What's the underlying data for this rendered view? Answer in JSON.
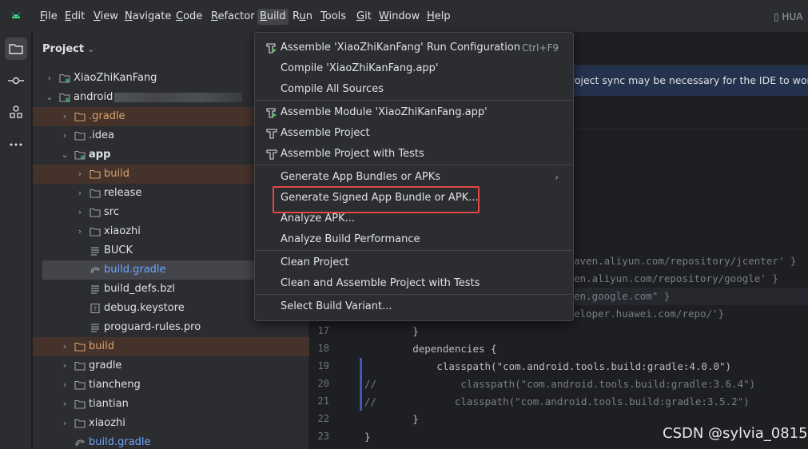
{
  "menubar": {
    "items": [
      {
        "label": "File",
        "mnemonic": "F"
      },
      {
        "label": "Edit",
        "mnemonic": "E"
      },
      {
        "label": "View",
        "mnemonic": "V"
      },
      {
        "label": "Navigate",
        "mnemonic": "N"
      },
      {
        "label": "Code",
        "mnemonic": "C"
      },
      {
        "label": "Refactor",
        "mnemonic": "R"
      },
      {
        "label": "Build",
        "mnemonic": "B"
      },
      {
        "label": "Run",
        "mnemonic": "u"
      },
      {
        "label": "Tools",
        "mnemonic": "T"
      },
      {
        "label": "Git",
        "mnemonic": "G"
      },
      {
        "label": "Window",
        "mnemonic": "W"
      },
      {
        "label": "Help",
        "mnemonic": "H"
      }
    ],
    "device": "HUA"
  },
  "project_panel": {
    "title": "Project",
    "tree": [
      {
        "label": "XiaoZhiKanFang",
        "style": "normal",
        "icon": "module-folder-icon"
      },
      {
        "label": "android",
        "style": "normal",
        "icon": "module-folder-icon"
      },
      {
        "label": ".gradle",
        "style": "orange",
        "icon": "folder-icon"
      },
      {
        "label": ".idea",
        "style": "normal",
        "icon": "folder-icon"
      },
      {
        "label": "app",
        "style": "bold",
        "icon": "module-folder-icon"
      },
      {
        "label": "build",
        "style": "orange",
        "icon": "folder-icon"
      },
      {
        "label": "release",
        "style": "normal",
        "icon": "folder-icon"
      },
      {
        "label": "src",
        "style": "normal",
        "icon": "folder-icon"
      },
      {
        "label": "xiaozhi",
        "style": "normal",
        "icon": "folder-icon"
      },
      {
        "label": "BUCK",
        "style": "normal",
        "icon": "text-file-icon"
      },
      {
        "label": "build.gradle",
        "style": "blue",
        "icon": "gradle-file-icon"
      },
      {
        "label": "build_defs.bzl",
        "style": "normal",
        "icon": "text-file-icon"
      },
      {
        "label": "debug.keystore",
        "style": "normal",
        "icon": "unknown-file-icon"
      },
      {
        "label": "proguard-rules.pro",
        "style": "normal",
        "icon": "text-file-icon"
      },
      {
        "label": "build",
        "style": "orange",
        "icon": "folder-icon"
      },
      {
        "label": "gradle",
        "style": "normal",
        "icon": "folder-icon"
      },
      {
        "label": "tiancheng",
        "style": "normal",
        "icon": "folder-icon"
      },
      {
        "label": "tiantian",
        "style": "normal",
        "icon": "folder-icon"
      },
      {
        "label": "xiaozhi",
        "style": "normal",
        "icon": "folder-icon"
      },
      {
        "label": "build.gradle",
        "style": "blue",
        "icon": "gradle-file-icon"
      }
    ]
  },
  "build_menu": {
    "items": [
      {
        "label": "Assemble 'XiaoZhiKanFang' Run Configuration",
        "shortcut": "Ctrl+F9",
        "icon": "assemble-run-config-icon"
      },
      {
        "label": "Compile 'XiaoZhiKanFang.app'",
        "shortcut": "",
        "icon": ""
      },
      {
        "label": "Compile All Sources",
        "shortcut": "",
        "icon": ""
      },
      {
        "label": "Assemble Module 'XiaoZhiKanFang.app'",
        "shortcut": "",
        "icon": "assemble-module-icon"
      },
      {
        "label": "Assemble Project",
        "shortcut": "",
        "icon": "hammer-icon"
      },
      {
        "label": "Assemble Project with Tests",
        "shortcut": "",
        "icon": "hammer-icon"
      },
      {
        "label": "Generate App Bundles or APKs",
        "shortcut": "",
        "icon": "",
        "submenu": true
      },
      {
        "label": "Generate Signed App Bundle or APK...",
        "shortcut": "",
        "icon": ""
      },
      {
        "label": "Analyze APK...",
        "shortcut": "",
        "icon": ""
      },
      {
        "label": "Analyze Build Performance",
        "shortcut": "",
        "icon": ""
      },
      {
        "label": "Clean Project",
        "shortcut": "",
        "icon": ""
      },
      {
        "label": "Clean and Assemble Project with Tests",
        "shortcut": "",
        "icon": ""
      },
      {
        "label": "Select Build Variant...",
        "shortcut": "",
        "icon": ""
      }
    ],
    "submenu_arrow": "›"
  },
  "editor": {
    "sync_banner": "roject sync may be necessary for the IDE to work p",
    "code_lines": [
      {
        "no": "",
        "text": "aven.aliyun.com/repository/jcenter' }",
        "kind": "url-partial-1"
      },
      {
        "no": "",
        "text": "en.aliyun.com/repository/google' }",
        "kind": "url-partial-2"
      },
      {
        "no": "",
        "text": "en.google.com\" }",
        "kind": "url-partial-3"
      },
      {
        "no": "",
        "text": "eloper.huawei.com/repo/'}",
        "kind": "url-partial-4"
      },
      {
        "no": "17",
        "text": "        }",
        "kind": "plain"
      },
      {
        "no": "18",
        "text": "        dependencies {",
        "kind": "plain"
      },
      {
        "no": "19",
        "text": "            classpath(\"com.android.tools.build:gradle:4.0.0\")",
        "kind": "classpath"
      },
      {
        "no": "20",
        "text": "//              classpath(\"com.android.tools.build:gradle:3.6.4\")",
        "kind": "comment"
      },
      {
        "no": "21",
        "text": "//             classpath(\"com.android.tools.build:gradle:3.5.2\")",
        "kind": "comment"
      },
      {
        "no": "22",
        "text": "        }",
        "kind": "plain"
      },
      {
        "no": "23",
        "text": "}",
        "kind": "plain"
      }
    ]
  },
  "watermark": "CSDN @sylvia_0815",
  "colors": {
    "accent": "#3574f0",
    "highlight_box": "#e04848",
    "ignored_folder": "#d8a36b",
    "gradle_file": "#6fa4ff"
  }
}
